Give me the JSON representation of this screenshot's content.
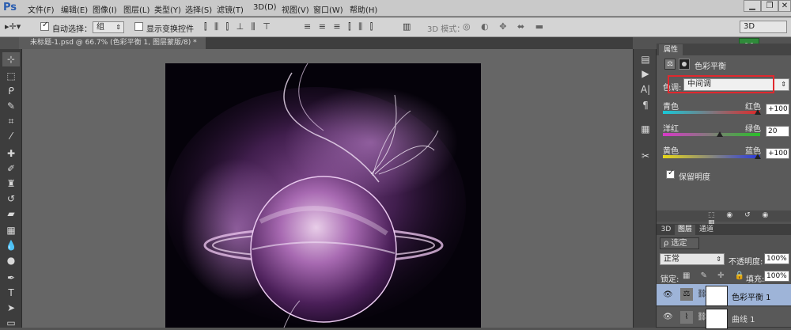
{
  "app": {
    "logo": "Ps",
    "title": "Photoshop"
  },
  "menu": [
    "文件(F)",
    "编辑(E)",
    "图像(I)",
    "图层(L)",
    "类型(Y)",
    "选择(S)",
    "滤镜(T)",
    "3D(D)",
    "视图(V)",
    "窗口(W)",
    "帮助(H)"
  ],
  "window_controls": {
    "minimize": "▁",
    "restore": "❐",
    "close": "✕"
  },
  "options": {
    "auto_select_label": "自动选择：",
    "auto_select_value": "组",
    "show_transform_label": "显示变换控件",
    "mode_3d_label": "3D 模式：",
    "workspace": "3D"
  },
  "document": {
    "tab_label": "未标题-1.psd @ 66.7% (色彩平衡 1, 图层蒙版/8) *",
    "close": "×"
  },
  "properties": {
    "tab": "属性",
    "title": "色彩平衡",
    "tone_label": "色调:",
    "tone_value": "中间调",
    "sliders": [
      {
        "left": "青色",
        "right": "红色",
        "value": "+100"
      },
      {
        "left": "洋红",
        "right": "绿色",
        "value": "20"
      },
      {
        "left": "黄色",
        "right": "蓝色",
        "value": "+100"
      }
    ],
    "preserve_label": "保留明度",
    "preserve_checked": true
  },
  "layers": {
    "tabs": [
      "3D",
      "图层",
      "通道"
    ],
    "active_tab": "图层",
    "filter": "ρ 选定",
    "blend_mode": "正常",
    "opacity_label": "不透明度:",
    "opacity_value": "100%",
    "lock_label": "锁定:",
    "fill_label": "填充:",
    "fill_value": "100%",
    "rows": [
      {
        "name": "色彩平衡 1",
        "selected": true
      },
      {
        "name": "曲线 1",
        "selected": false
      }
    ]
  },
  "colors": {
    "accent": "#2a5db0",
    "highlight_box": "#e0282e",
    "layer_selected": "#9eb4d8"
  }
}
